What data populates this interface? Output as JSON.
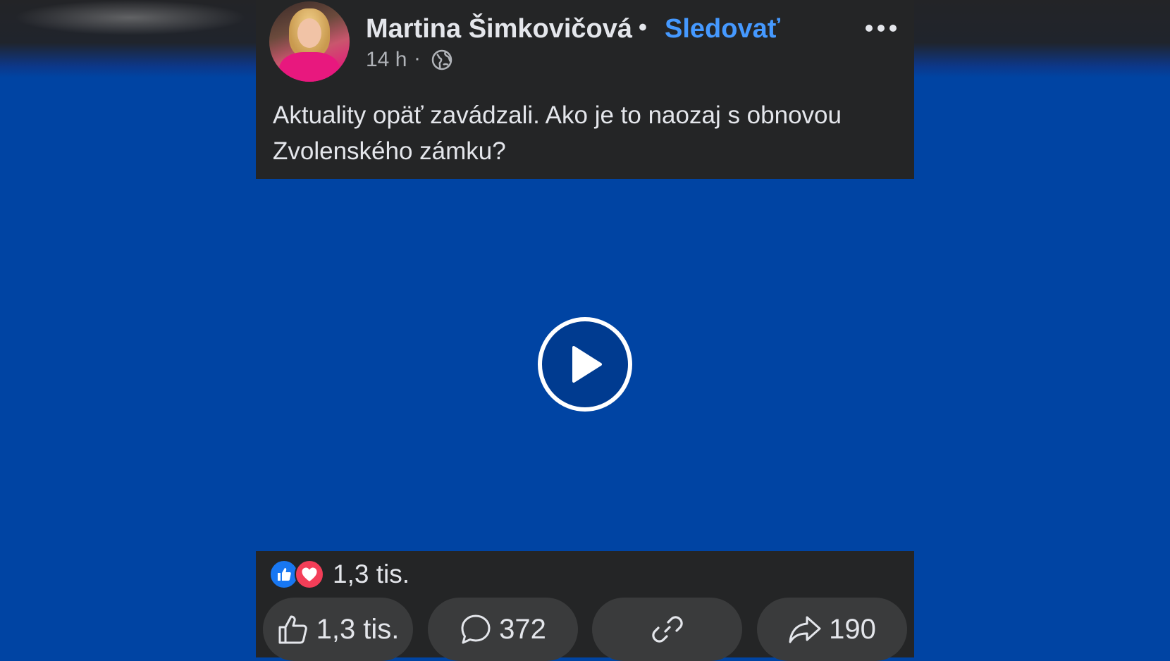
{
  "post": {
    "author": "Martina Šimkovičová",
    "separator": "•",
    "follow_label": "Sledovať",
    "timestamp": "14 h",
    "time_separator": "·",
    "audience_icon": "globe-icon",
    "text": "Aktuality opäť zavádzali. Ako je to naozaj s obnovou Zvolenského zámku?"
  },
  "video": {
    "play_icon": "play-icon",
    "background_color": "#0044a3"
  },
  "reactions": {
    "types": [
      "like",
      "love"
    ],
    "count": "1,3 tis."
  },
  "actions": {
    "like_count": "1,3 tis.",
    "comment_count": "372",
    "share_count": "190"
  },
  "colors": {
    "accent": "#4599ff",
    "card": "#242526",
    "button": "#3a3b3c"
  }
}
